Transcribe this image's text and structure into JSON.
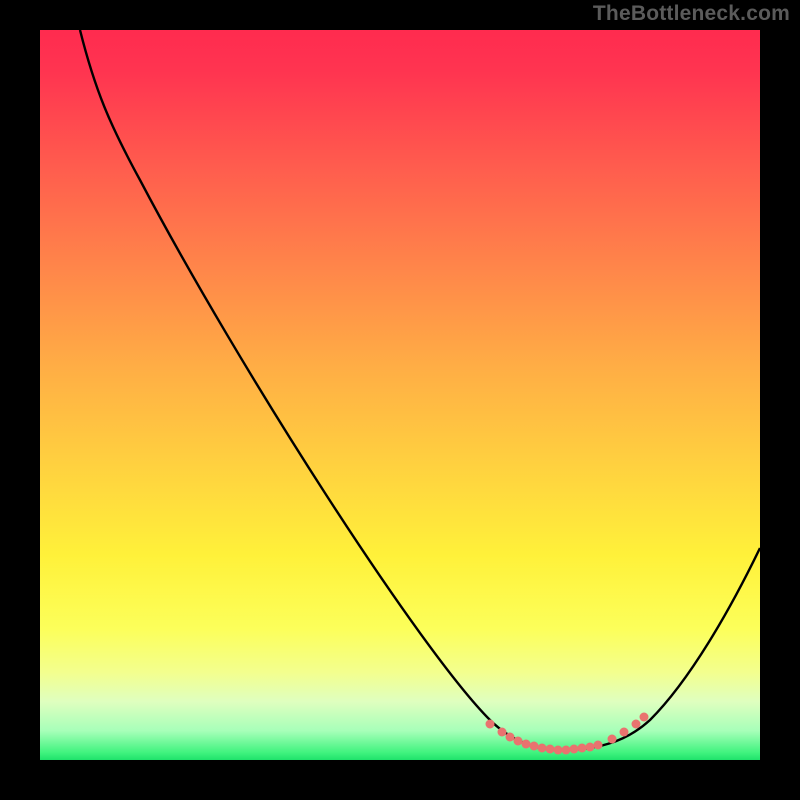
{
  "attribution": "TheBottleneck.com",
  "chart_data": {
    "type": "line",
    "title": "",
    "xlabel": "",
    "ylabel": "",
    "xlim": [
      0,
      100
    ],
    "ylim": [
      0,
      100
    ],
    "background_gradient": {
      "top_color": "#ff2b4f",
      "bottom_color": "#1fe26b",
      "meaning": "red (high bottleneck) to green (low bottleneck)"
    },
    "series": [
      {
        "name": "bottleneck-curve",
        "color": "#000000",
        "x": [
          6,
          10,
          15,
          20,
          25,
          30,
          35,
          40,
          45,
          50,
          55,
          60,
          63,
          68,
          72,
          76,
          80,
          85,
          90,
          95,
          100
        ],
        "y": [
          100,
          94,
          87,
          79,
          71,
          62,
          54,
          46,
          37,
          28,
          20,
          11,
          5,
          2,
          1,
          1,
          2,
          6,
          12,
          20,
          29
        ]
      }
    ],
    "highlight": {
      "name": "optimal-range-dots",
      "color": "#e9736f",
      "x": [
        63,
        64,
        65,
        66,
        67,
        68,
        69,
        70,
        71,
        72,
        73,
        74,
        75,
        76,
        78,
        80,
        82,
        84
      ],
      "y": [
        5,
        4,
        3.3,
        2.7,
        2.2,
        1.8,
        1.5,
        1.3,
        1.1,
        1,
        1,
        1.1,
        1.3,
        1.6,
        2.2,
        3,
        4,
        5
      ]
    }
  }
}
